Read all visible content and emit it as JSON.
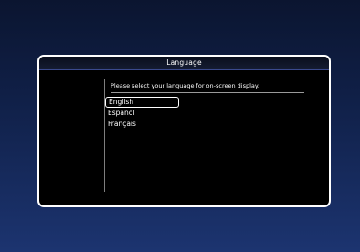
{
  "dialog": {
    "title": "Language",
    "prompt": "Please select your language for on-screen display.",
    "selected_index": 0,
    "languages": [
      {
        "label": "English"
      },
      {
        "label": "Español"
      },
      {
        "label": "Français"
      }
    ]
  }
}
